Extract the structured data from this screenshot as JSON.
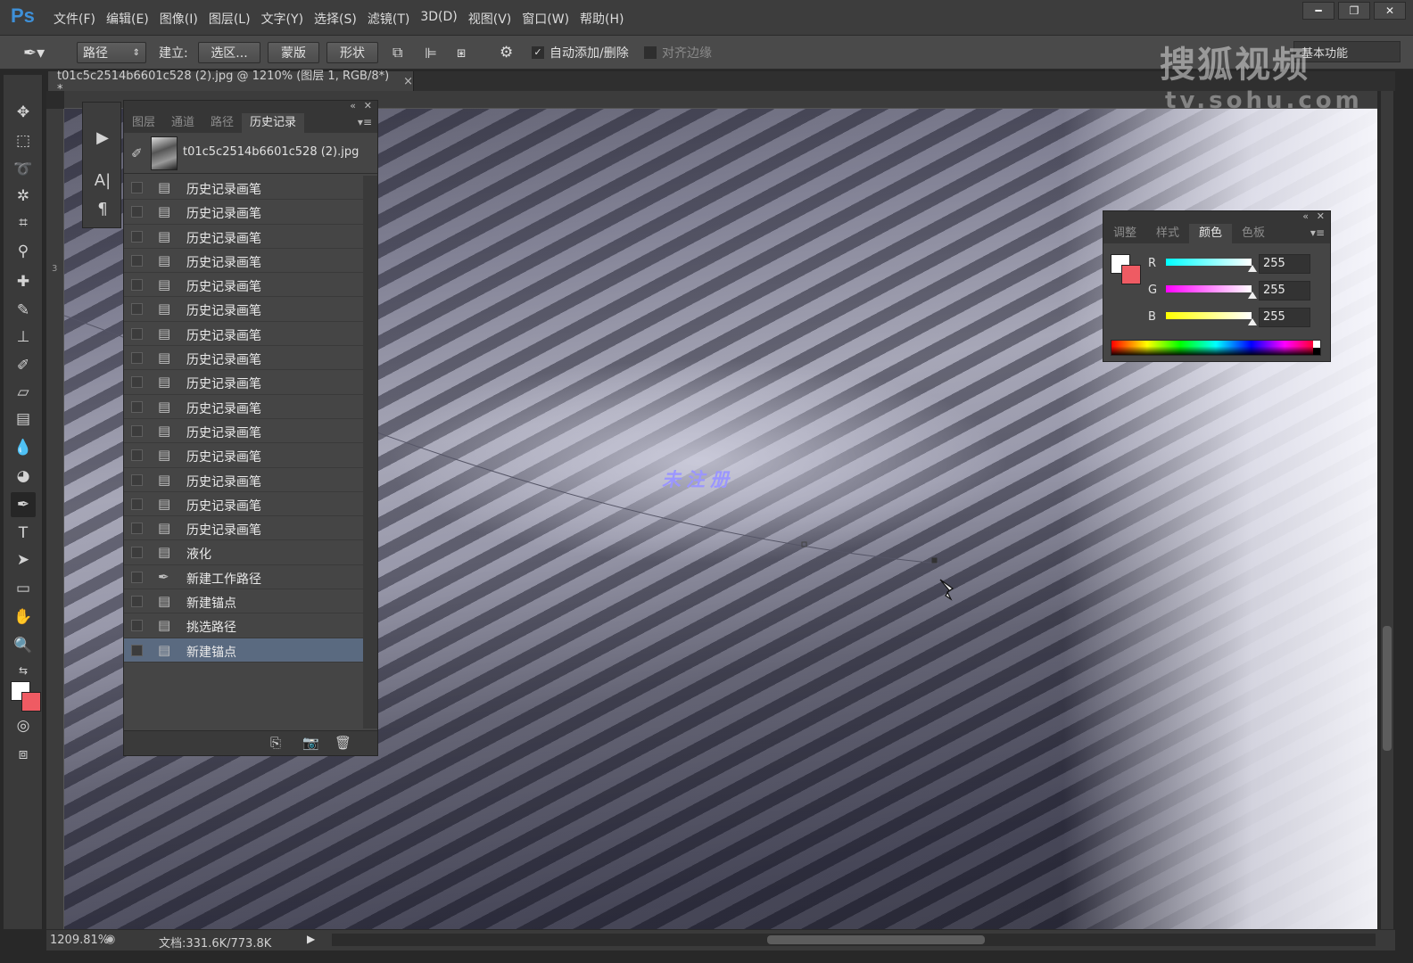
{
  "app": {
    "logo": "Ps",
    "menus": [
      "文件(F)",
      "编辑(E)",
      "图像(I)",
      "图层(L)",
      "文字(Y)",
      "选择(S)",
      "滤镜(T)",
      "3D(D)",
      "视图(V)",
      "窗口(W)",
      "帮助(H)"
    ],
    "window_buttons": [
      "━",
      "❐",
      "✕"
    ]
  },
  "options_bar": {
    "mode_select": "路径",
    "make_label": "建立:",
    "selection_button": "选区...",
    "mask_button": "蒙版",
    "shape_button": "形状",
    "auto_add_delete_label": "自动添加/删除",
    "auto_add_delete_checked": true,
    "align_edges_label": "对齐边缘",
    "align_edges_checked": false,
    "workspace": "基本功能"
  },
  "document": {
    "tab_title": "t01c5c2514b6601c528 (2).jpg @ 1210% (图层 1, RGB/8*) *",
    "tab_close": "×",
    "ruler_mark": "3",
    "canvas_watermark": "未注册"
  },
  "status_bar": {
    "zoom": "1209.81%",
    "doc_info": "文档:331.6K/773.8K"
  },
  "watermark": {
    "line1": "搜狐视频",
    "line2": "tv.sohu.com"
  },
  "history_panel": {
    "tabs": [
      "图层",
      "通道",
      "路径",
      "历史记录"
    ],
    "active_tab": "历史记录",
    "snapshot_name": "t01c5c2514b6601c528 (2).jpg",
    "items": [
      {
        "label": "历史记录画笔",
        "icon": "document-icon"
      },
      {
        "label": "历史记录画笔",
        "icon": "document-icon"
      },
      {
        "label": "历史记录画笔",
        "icon": "document-icon"
      },
      {
        "label": "历史记录画笔",
        "icon": "document-icon"
      },
      {
        "label": "历史记录画笔",
        "icon": "document-icon"
      },
      {
        "label": "历史记录画笔",
        "icon": "document-icon"
      },
      {
        "label": "历史记录画笔",
        "icon": "document-icon"
      },
      {
        "label": "历史记录画笔",
        "icon": "document-icon"
      },
      {
        "label": "历史记录画笔",
        "icon": "document-icon"
      },
      {
        "label": "历史记录画笔",
        "icon": "document-icon"
      },
      {
        "label": "历史记录画笔",
        "icon": "document-icon"
      },
      {
        "label": "历史记录画笔",
        "icon": "document-icon"
      },
      {
        "label": "历史记录画笔",
        "icon": "document-icon"
      },
      {
        "label": "历史记录画笔",
        "icon": "document-icon"
      },
      {
        "label": "历史记录画笔",
        "icon": "document-icon"
      },
      {
        "label": "液化",
        "icon": "document-icon"
      },
      {
        "label": "新建工作路径",
        "icon": "pen-icon"
      },
      {
        "label": "新建锚点",
        "icon": "document-icon"
      },
      {
        "label": "挑选路径",
        "icon": "document-icon"
      },
      {
        "label": "新建锚点",
        "icon": "document-icon"
      }
    ],
    "selected_index": 19
  },
  "color_panel": {
    "tabs": [
      "调整",
      "样式",
      "颜色",
      "色板"
    ],
    "active_tab": "颜色",
    "channels": [
      {
        "name": "R",
        "value": "255"
      },
      {
        "name": "G",
        "value": "255"
      },
      {
        "name": "B",
        "value": "255"
      }
    ],
    "foreground": "#ffffff",
    "background": "#ef5b63"
  }
}
